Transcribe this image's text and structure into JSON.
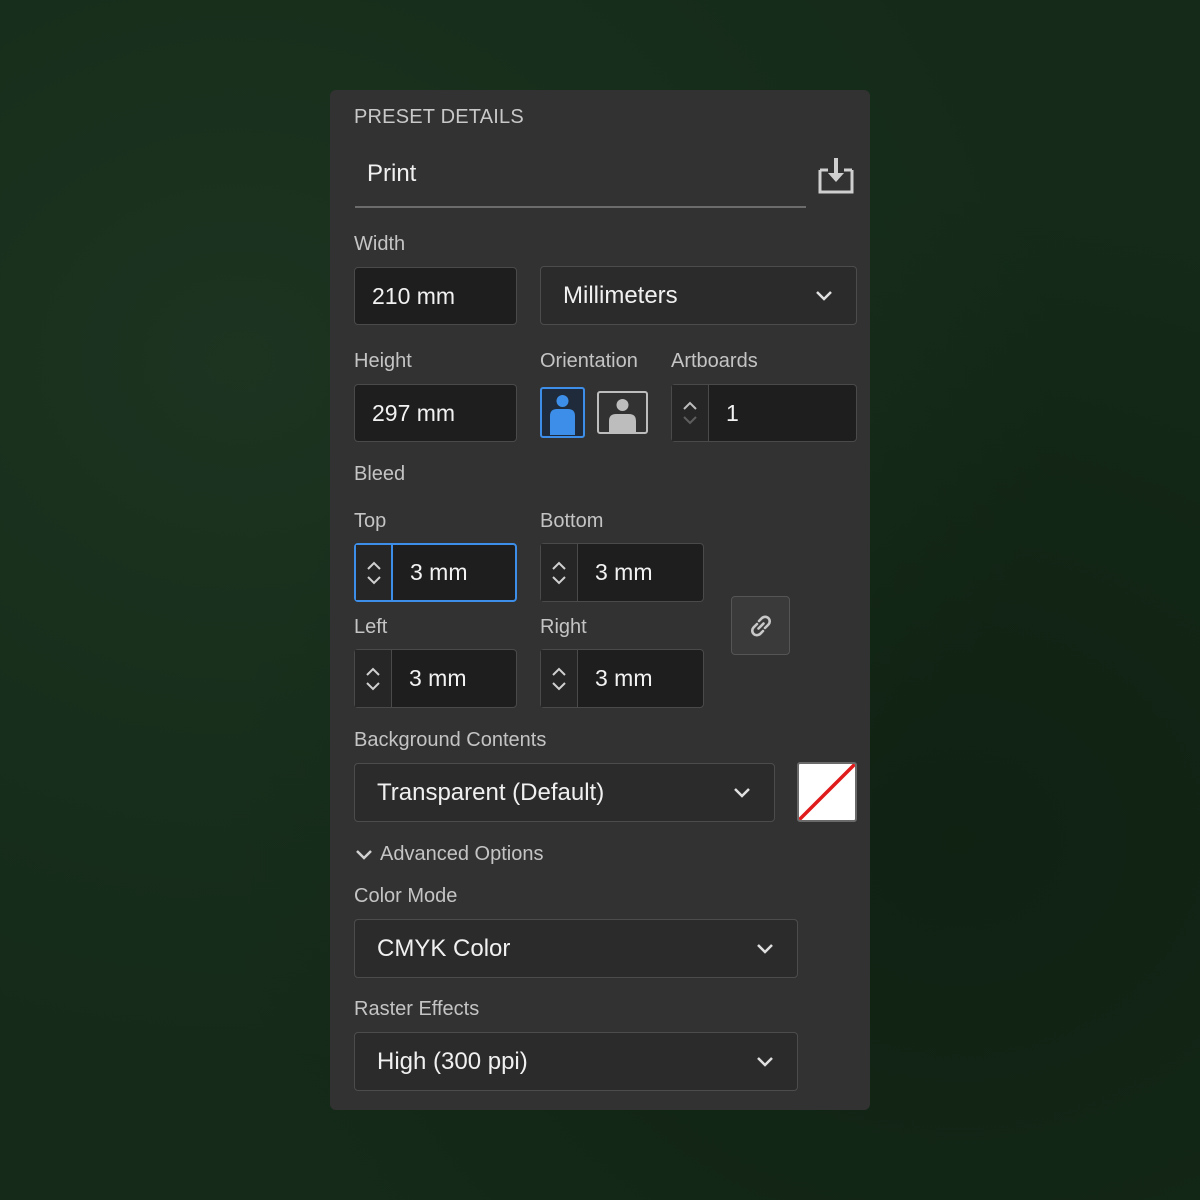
{
  "panel": {
    "section_title": "PRESET DETAILS",
    "preset_name": "Print"
  },
  "width": {
    "label": "Width",
    "value": "210 mm",
    "units": "Millimeters"
  },
  "height": {
    "label": "Height",
    "value": "297 mm"
  },
  "orientation": {
    "label": "Orientation",
    "selected": "portrait"
  },
  "artboards": {
    "label": "Artboards",
    "value": "1"
  },
  "bleed": {
    "label": "Bleed",
    "top_label": "Top",
    "top_value": "3 mm",
    "bottom_label": "Bottom",
    "bottom_value": "3 mm",
    "left_label": "Left",
    "left_value": "3 mm",
    "right_label": "Right",
    "right_value": "3 mm"
  },
  "background": {
    "label": "Background Contents",
    "value": "Transparent (Default)"
  },
  "advanced": {
    "toggle_label": "Advanced Options",
    "color_mode_label": "Color Mode",
    "color_mode_value": "CMYK Color",
    "raster_label": "Raster Effects",
    "raster_value": "High (300 ppi)"
  },
  "colors": {
    "accent": "#3d8ee8",
    "panel_bg": "#323232",
    "page_bg": "#152a19"
  }
}
